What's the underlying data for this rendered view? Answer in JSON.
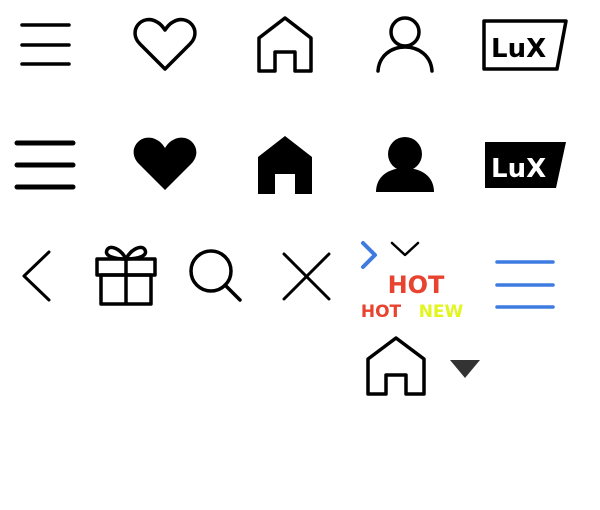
{
  "icons": {
    "row1": [
      "menu-icon",
      "heart-outline-icon",
      "home-outline-icon",
      "user-outline-icon",
      "lux-logo-outline"
    ],
    "row2": [
      "menu-icon",
      "heart-filled-icon",
      "home-filled-icon",
      "user-filled-icon",
      "lux-logo-filled"
    ],
    "row3": [
      "chevron-left-icon",
      "gift-icon",
      "search-icon",
      "close-icon",
      "chevron-right-icon",
      "chevron-down-icon",
      "menu-icon"
    ],
    "row4": [
      "home-outline-icon",
      "caret-down-icon"
    ]
  },
  "logo": {
    "outline_text": "LuX",
    "filled_text": "LuX"
  },
  "badges": {
    "hot_large": "HOT",
    "hot_small": "HOT",
    "new_small": "NEW"
  },
  "colors": {
    "icon": "#000000",
    "accent_blue": "#3e7be0",
    "hot_red": "#e8432f",
    "new_yellow": "#e2f51f",
    "caret": "#333333"
  }
}
